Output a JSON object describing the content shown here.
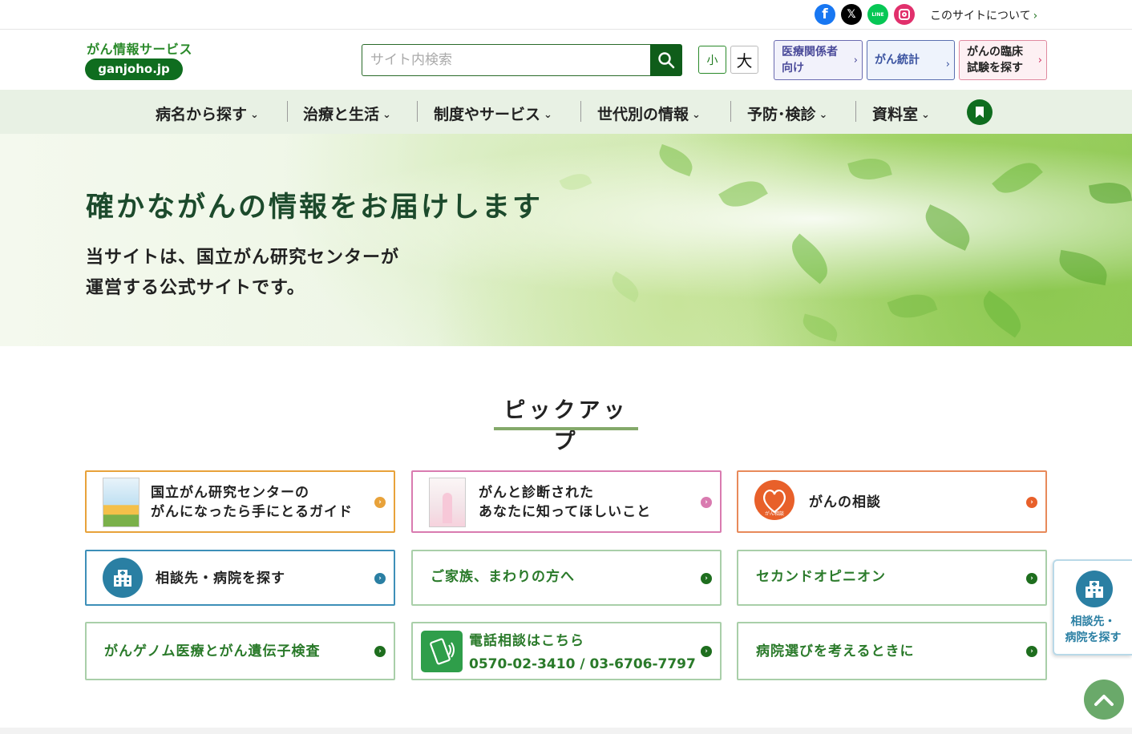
{
  "topbar": {
    "social": [
      {
        "name": "facebook",
        "glyph": "f"
      },
      {
        "name": "x",
        "glyph": "𝕏"
      },
      {
        "name": "line",
        "glyph": "LINE"
      },
      {
        "name": "instagram",
        "glyph": ""
      }
    ],
    "about_label": "このサイトについて"
  },
  "header": {
    "logo_text": "がん情報サービス",
    "logo_badge": "ganjoho.jp",
    "search_placeholder": "サイト内検索",
    "font_small": "小",
    "font_large": "大",
    "buttons": [
      {
        "line1": "医療関係者",
        "line2": "向け"
      },
      {
        "line1": "がん統計"
      },
      {
        "line1": "がんの臨床",
        "line2": "試験を探す"
      }
    ]
  },
  "nav": {
    "items": [
      {
        "label": "病名から探す"
      },
      {
        "label": "治療と生活"
      },
      {
        "label": "制度やサービス"
      },
      {
        "label": "世代別の情報"
      },
      {
        "label": "予防･検診"
      },
      {
        "label": "資料室"
      }
    ]
  },
  "hero": {
    "title": "確かながんの情報をお届けします",
    "line1": "当サイトは、国立がん研究センターが",
    "line2": "運営する公式サイトです。"
  },
  "pickup": {
    "title": "ピックアップ",
    "cards": [
      {
        "line1": "国立がん研究センターの",
        "line2": "がんになったら手にとるガイド"
      },
      {
        "line1": "がんと診断された",
        "line2": "あなたに知ってほしいこと"
      },
      {
        "line1": "がんの相談",
        "icon_text": "がん相談"
      },
      {
        "line1": "相談先・病院を探す"
      },
      {
        "line1": "ご家族、まわりの方へ"
      },
      {
        "line1": "セカンドオピニオン"
      },
      {
        "line1": "がんゲノム医療とがん遺伝子検査"
      },
      {
        "line1": "電話相談はこちら",
        "line2": "0570-02-3410 / 03-6706-7797"
      },
      {
        "line1": "病院選びを考えるときに"
      }
    ]
  },
  "floating": {
    "hospital_line1": "相談先・",
    "hospital_line2": "病院を探す"
  },
  "colors": {
    "brand_green": "#0f6d1f",
    "nav_bg": "#e8f1e4",
    "link_green": "#2a7a2a",
    "hospital_blue": "#2a7fa3"
  }
}
